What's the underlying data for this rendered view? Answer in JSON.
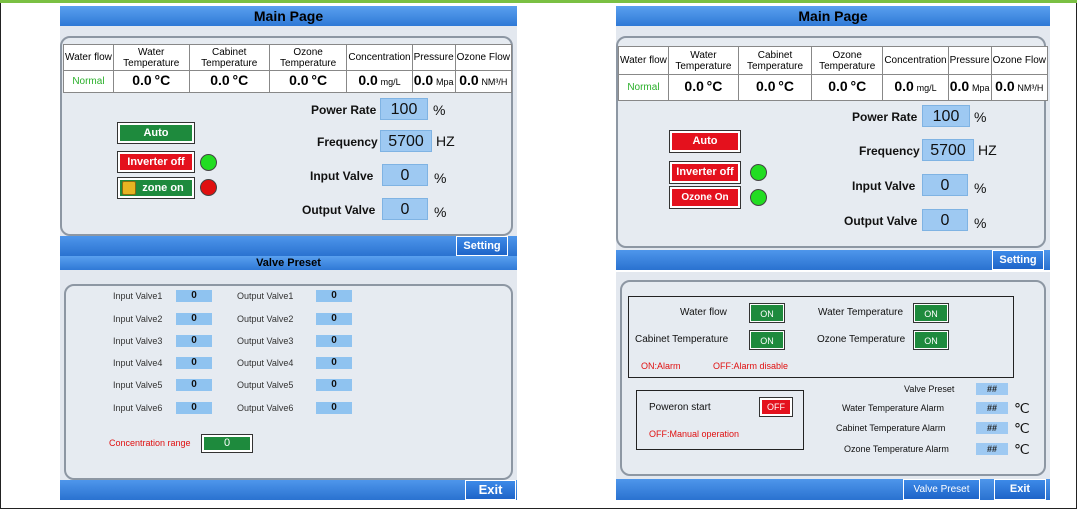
{
  "left": {
    "main_title": "Main Page",
    "headers": [
      "Water flow",
      "Water Temperature",
      "Cabinet Temperature",
      "Ozone Temperature",
      "Concentration",
      "Pressure",
      "Ozone Flow"
    ],
    "values": [
      "Normal",
      "0.0",
      "0.0",
      "0.0",
      "0.0",
      "0.0",
      "0.0"
    ],
    "units": [
      "",
      "°C",
      "°C",
      "°C",
      "mg/L",
      "Mpa",
      "NM³/H"
    ],
    "power_rate_label": "Power Rate",
    "power_rate_value": "100",
    "frequency_label": "Frequency",
    "frequency_value": "5700",
    "frequency_unit": "HZ",
    "input_valve_label": "Input Valve",
    "input_valve_value": "0",
    "output_valve_label": "Output Valve",
    "output_valve_value": "0",
    "percent": "%",
    "auto_label": "Auto",
    "inverter_label": "Inverter off",
    "ozone_label": "zone on",
    "setting_label": "Setting",
    "valve_preset_title": "Valve Preset",
    "input_valves": [
      "Input Valve1",
      "Input Valve2",
      "Input Valve3",
      "Input Valve4",
      "Input Valve5",
      "Input Valve6"
    ],
    "output_valves": [
      "Output Valve1",
      "Output Valve2",
      "Output Valve3",
      "Output Valve4",
      "Output Valve5",
      "Output Valve6"
    ],
    "preset_value": "0",
    "concentration_range_label": "Concentration range",
    "concentration_range_value": "0",
    "exit_label": "Exit"
  },
  "right": {
    "main_title": "Main Page",
    "headers": [
      "Water flow",
      "Water Temperature",
      "Cabinet Temperature",
      "Ozone Temperature",
      "Concentration",
      "Pressure",
      "Ozone Flow"
    ],
    "values": [
      "Normal",
      "0.0",
      "0.0",
      "0.0",
      "0.0",
      "0.0",
      "0.0"
    ],
    "units": [
      "",
      "°C",
      "°C",
      "°C",
      "mg/L",
      "Mpa",
      "NM³/H"
    ],
    "power_rate_label": "Power Rate",
    "power_rate_value": "100",
    "frequency_label": "Frequency",
    "frequency_value": "5700",
    "frequency_unit": "HZ",
    "input_valve_label": "Input Valve",
    "input_valve_value": "0",
    "output_valve_label": "Output Valve",
    "output_valve_value": "0",
    "percent": "%",
    "auto_label": "Auto",
    "inverter_label": "Inverter off",
    "ozone_label": "Ozone On",
    "setting_label": "Setting",
    "alarm_labels": {
      "water_flow": "Water flow",
      "water_temp": "Water Temperature",
      "cabinet_temp": "Cabinet Temperature",
      "ozone_temp": "Ozone Temperature"
    },
    "on_label": "ON",
    "on_alarm": "ON:Alarm",
    "off_alarm": "OFF:Alarm disable",
    "poweron_label": "Poweron start",
    "off_label": "OFF",
    "manual_label": "OFF:Manual operation",
    "valve_preset_label": "Valve Preset",
    "water_temp_alarm": "Water Temperature Alarm",
    "cabinet_temp_alarm": "Cabinet Temperature Alarm",
    "ozone_temp_alarm": "Ozone Temperature Alarm",
    "hash": "##",
    "celsius": "℃",
    "valve_preset_btn": "Valve Preset",
    "exit_label": "Exit"
  },
  "colors": {
    "green": "#1e8a3d",
    "red": "#e4111d",
    "blue": "#2f79d6",
    "indicator_green": "#22dd22",
    "indicator_red": "#e01010"
  }
}
